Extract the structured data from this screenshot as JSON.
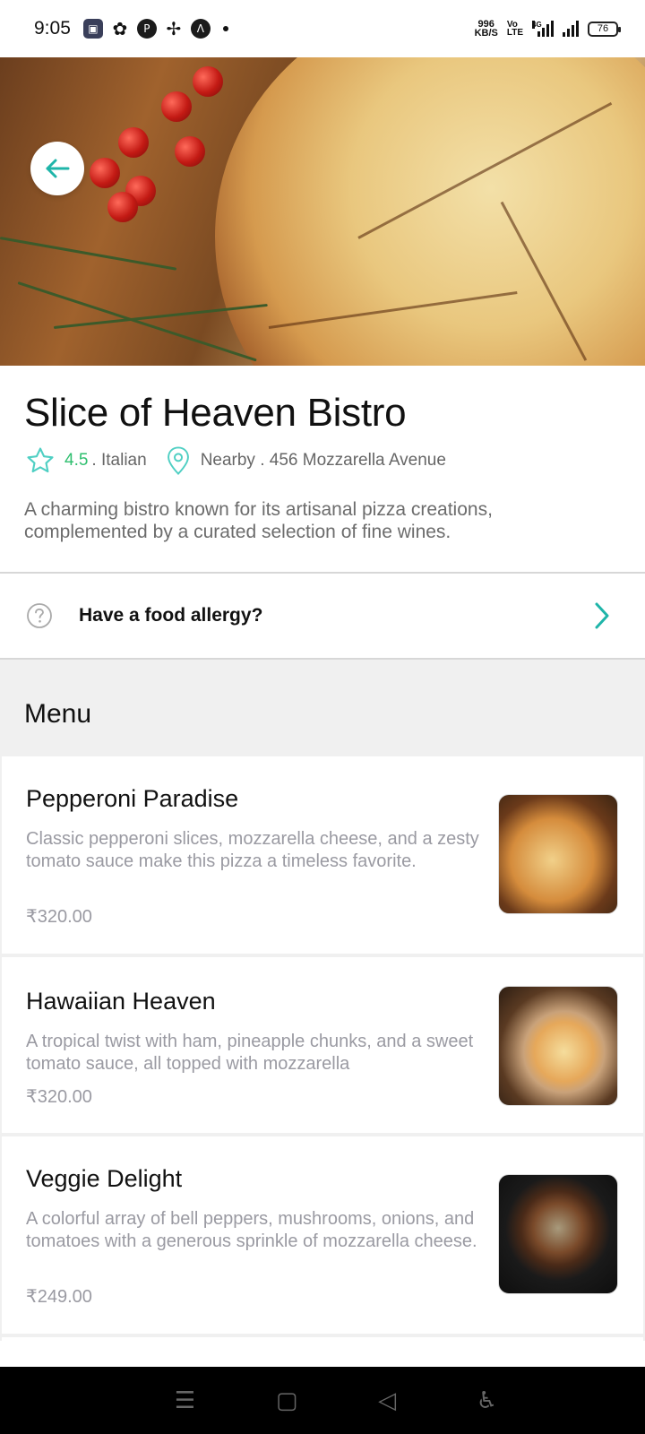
{
  "status_bar": {
    "time": "9:05",
    "speed_value": "996",
    "speed_unit": "KB/S",
    "volte_top": "Vo",
    "volte_bottom": "LTE",
    "network_tag": "4G",
    "battery": "76"
  },
  "hero": {
    "back_icon": "arrow-left-icon",
    "accent_color": "#1fb5a9"
  },
  "restaurant": {
    "name": "Slice of Heaven Bistro",
    "rating": "4.5",
    "cuisine": ". Italian",
    "location": "Nearby . 456 Mozzarella Avenue",
    "description": "A charming bistro known for its artisanal pizza creations, complemented by a curated selection of fine wines."
  },
  "allergy": {
    "label": "Have a food allergy?",
    "icon": "help-circle-icon"
  },
  "menu": {
    "title": "Menu",
    "items": [
      {
        "name": "Pepperoni Paradise",
        "description": "Classic pepperoni slices, mozzarella cheese, and a zesty tomato sauce make this pizza a timeless favorite.",
        "price": "₹320.00"
      },
      {
        "name": "Hawaiian Heaven",
        "description": "A tropical twist with ham, pineapple chunks, and a sweet tomato sauce, all topped with mozzarella",
        "price": "₹320.00"
      },
      {
        "name": "Veggie Delight",
        "description": "A colorful array of bell peppers, mushrooms, onions, and tomatoes with a generous sprinkle of mozzarella cheese.",
        "price": "₹249.00"
      }
    ]
  },
  "nav_bar": {
    "menu_icon": "menu-icon",
    "home_icon": "home-square-icon",
    "back_icon": "back-triangle-icon",
    "accessibility_icon": "accessibility-icon"
  }
}
